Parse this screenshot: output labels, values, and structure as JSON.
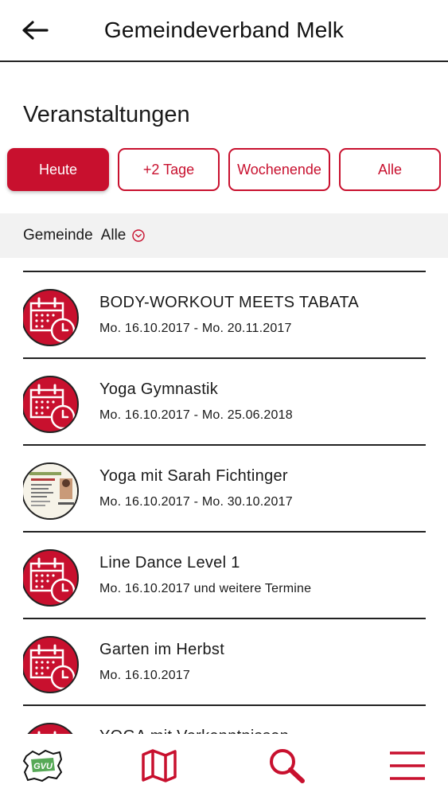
{
  "header": {
    "title": "Gemeindeverband Melk",
    "back_icon": "arrow-left-icon"
  },
  "section": {
    "title": "Veranstaltungen"
  },
  "filters": [
    {
      "label": "Heute",
      "active": true
    },
    {
      "label": "+2 Tage",
      "active": false
    },
    {
      "label": "Wochenende",
      "active": false
    },
    {
      "label": "Alle",
      "active": false
    }
  ],
  "gemeinde": {
    "label": "Gemeinde",
    "value": "Alle",
    "icon": "chevron-down-circle-icon"
  },
  "events": [
    {
      "title": "BODY-WORKOUT MEETS TABATA",
      "date": "Mo. 16.10.2017 - Mo. 20.11.2017",
      "icon": "calendar-clock-icon"
    },
    {
      "title": "Yoga Gymnastik",
      "date": "Mo. 16.10.2017 - Mo. 25.06.2018",
      "icon": "calendar-clock-icon"
    },
    {
      "title": "Yoga mit Sarah Fichtinger",
      "date": "Mo. 16.10.2017 - Mo. 30.10.2017",
      "icon": "event-flyer-thumbnail"
    },
    {
      "title": "Line Dance Level 1",
      "date": "Mo. 16.10.2017 und weitere Termine",
      "icon": "calendar-clock-icon"
    },
    {
      "title": "Garten im Herbst",
      "date": "Mo. 16.10.2017",
      "icon": "calendar-clock-icon"
    },
    {
      "title": "YOGA mit Vorkenntnissen",
      "date": "",
      "icon": "calendar-clock-icon"
    }
  ],
  "tabbar": {
    "items": [
      {
        "name": "gvu-logo-icon",
        "logo_text": "GVU"
      },
      {
        "name": "map-icon"
      },
      {
        "name": "search-icon"
      },
      {
        "name": "menu-icon"
      }
    ]
  },
  "colors": {
    "accent": "#c8102e",
    "text": "#1a1a1a",
    "bar_bg": "#f2f2f2"
  }
}
